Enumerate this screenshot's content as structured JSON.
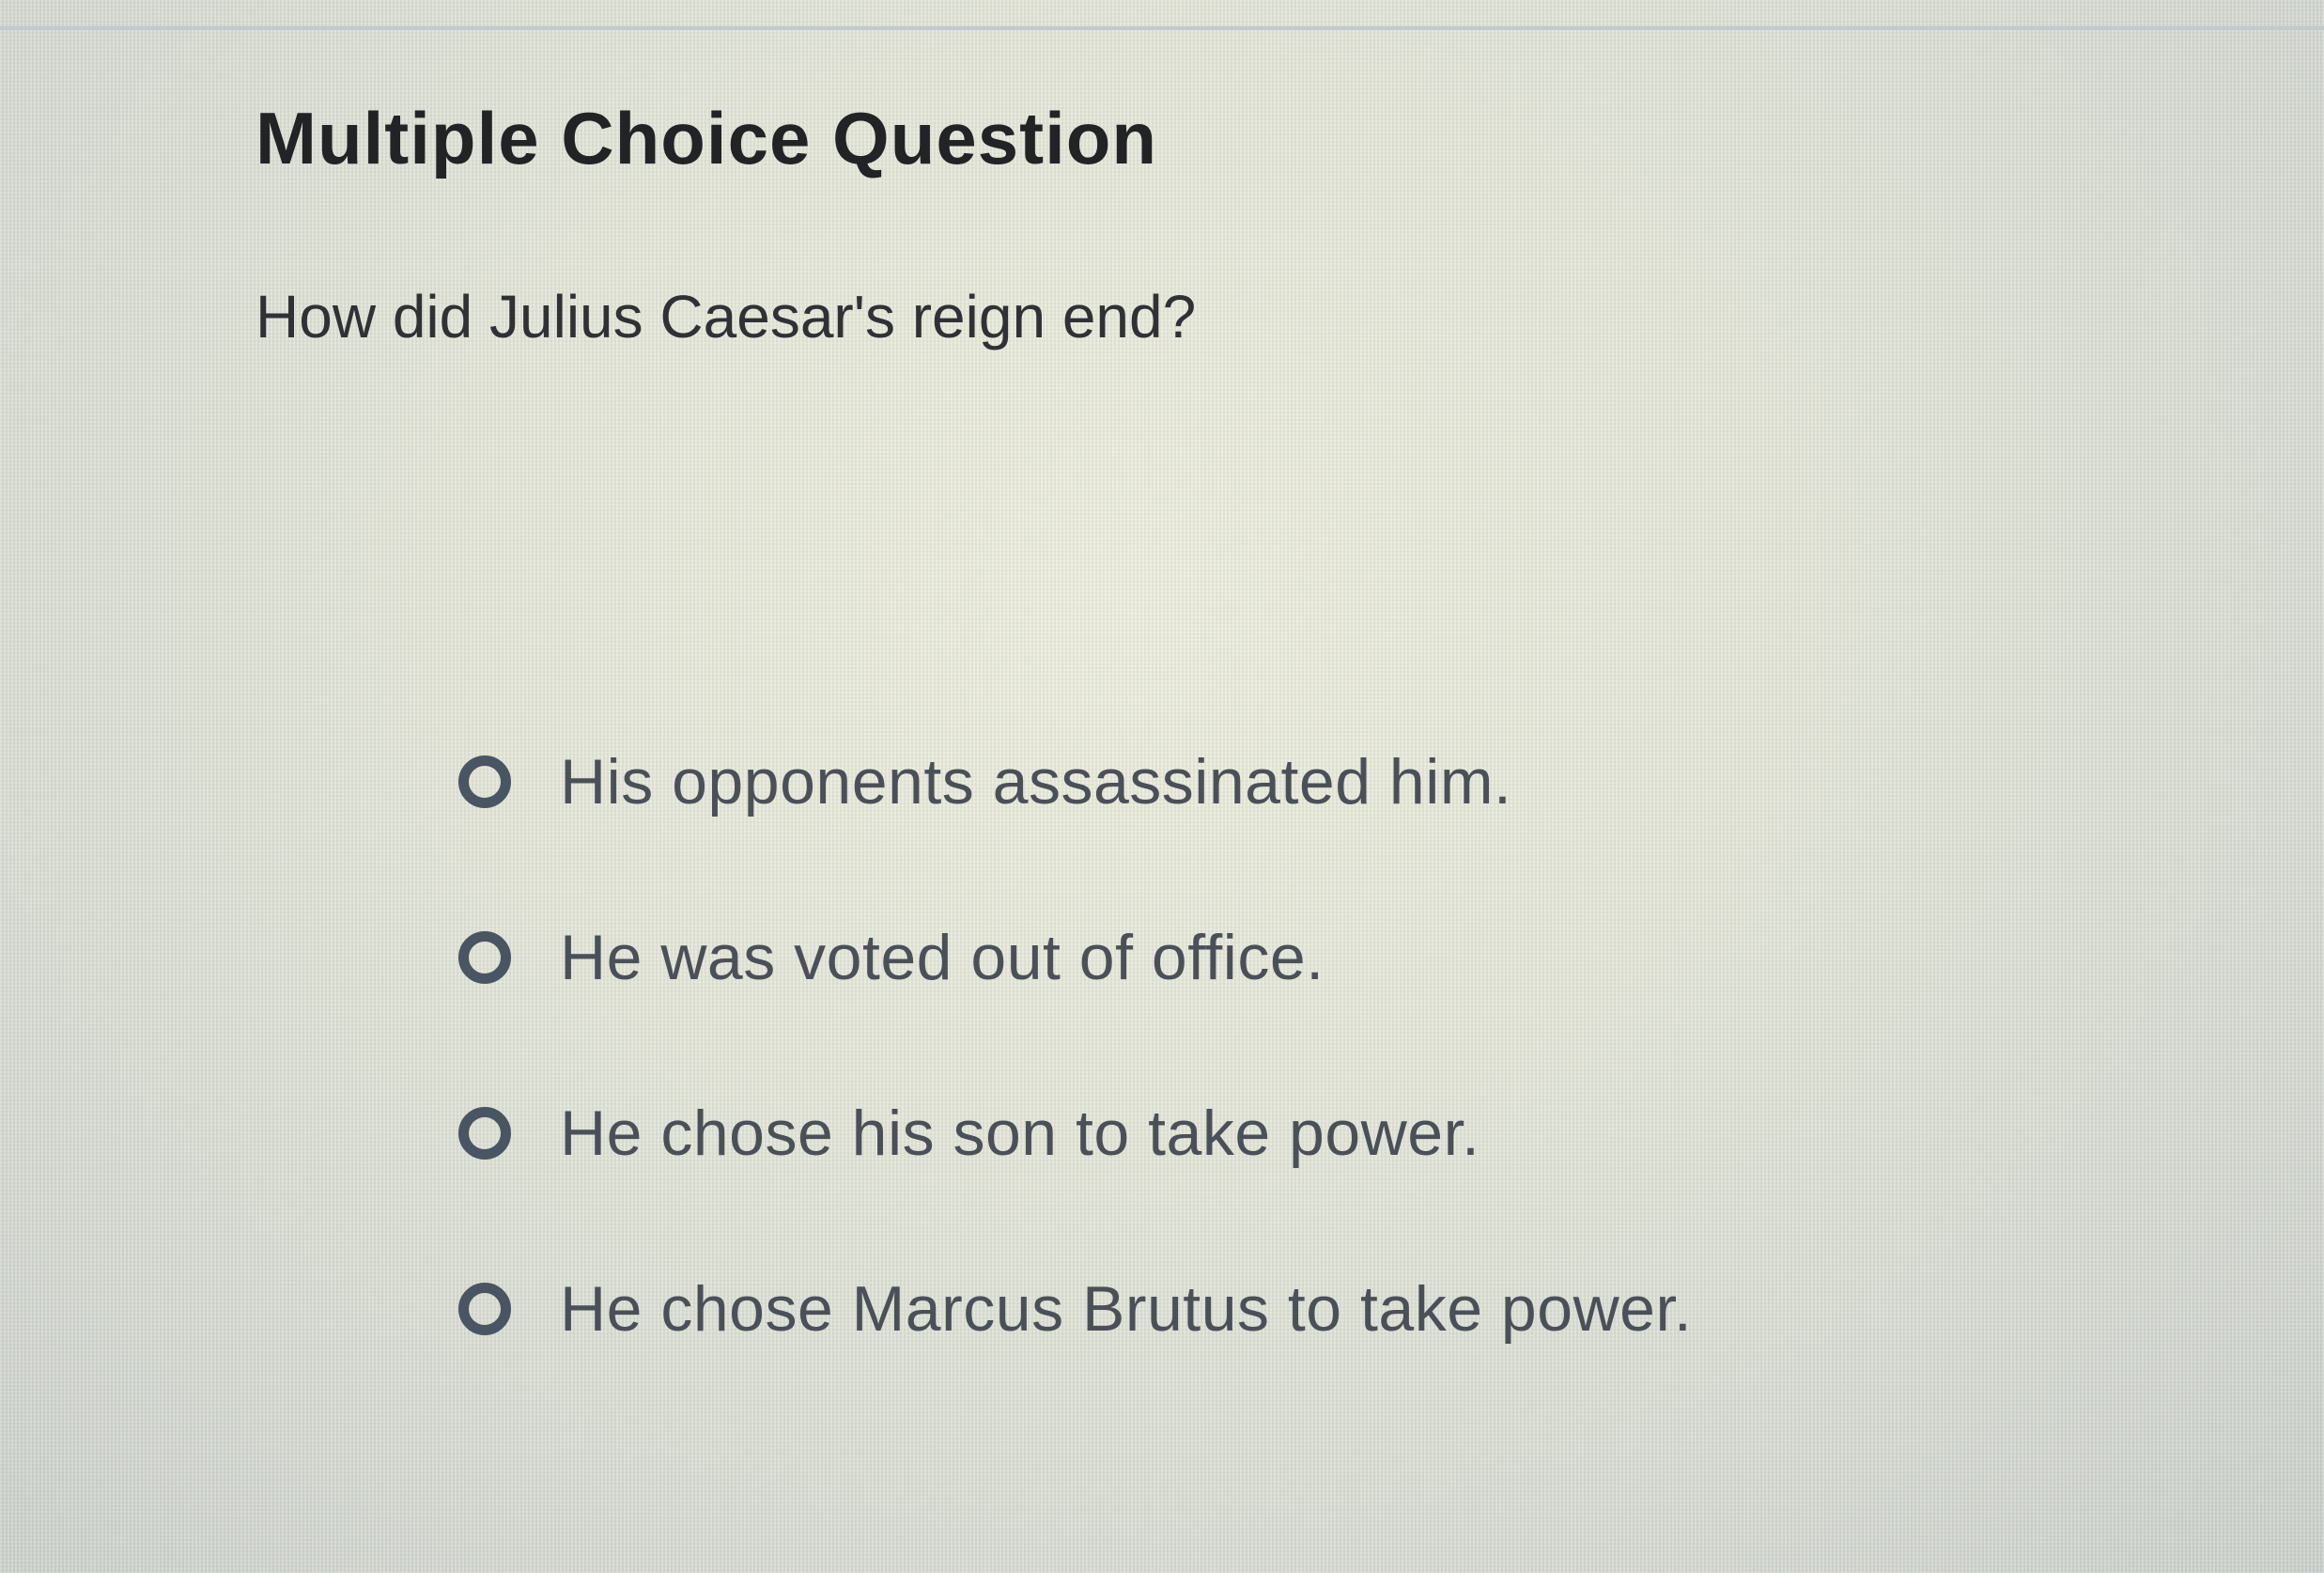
{
  "question": {
    "title": "Multiple Choice Question",
    "prompt": "How did Julius Caesar's reign end?",
    "options": [
      {
        "label": "His opponents assassinated him.",
        "selected": false
      },
      {
        "label": "He was voted out of office.",
        "selected": false
      },
      {
        "label": "He chose his son to take power.",
        "selected": false
      },
      {
        "label": "He chose Marcus Brutus to take power.",
        "selected": false
      }
    ]
  },
  "colors": {
    "title_text": "#222325",
    "option_text": "#4b5058",
    "radio_border": "#4a5563"
  }
}
